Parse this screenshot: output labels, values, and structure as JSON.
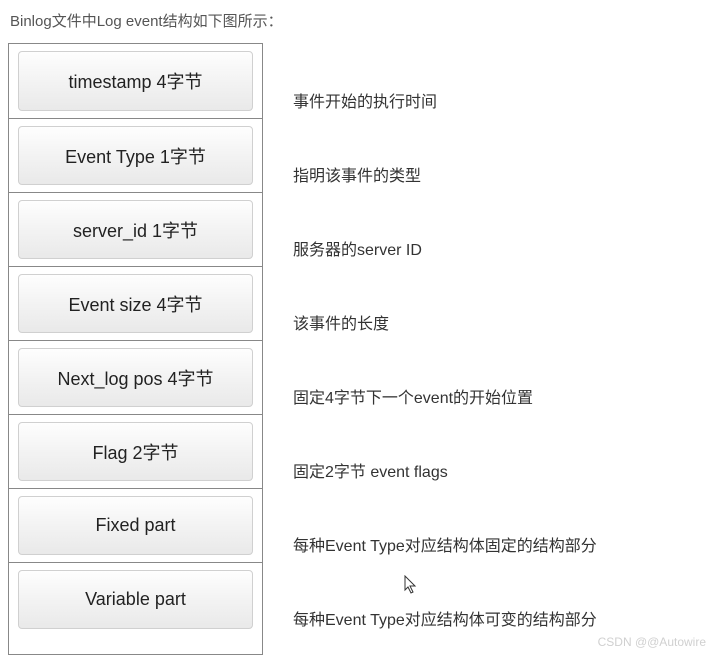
{
  "title": "Binlog文件中Log event结构如下图所示：",
  "rows": [
    {
      "label": "timestamp 4字节",
      "desc": "事件开始的执行时间"
    },
    {
      "label": "Event Type 1字节",
      "desc": "指明该事件的类型"
    },
    {
      "label": "server_id 1字节",
      "desc": "服务器的server ID"
    },
    {
      "label": "Event size  4字节",
      "desc": "该事件的长度"
    },
    {
      "label": "Next_log pos 4字节",
      "desc": "固定4字节下一个event的开始位置"
    },
    {
      "label": "Flag 2字节",
      "desc": "固定2字节 event flags"
    },
    {
      "label": "Fixed part",
      "desc": "每种Event Type对应结构体固定的结构部分"
    },
    {
      "label": "Variable part",
      "desc": "每种Event Type对应结构体可变的结构部分"
    }
  ],
  "watermark": "CSDN @@Autowire"
}
